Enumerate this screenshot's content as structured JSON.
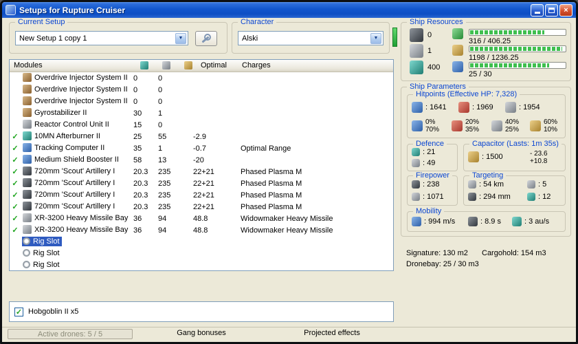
{
  "icons": {
    "dropdown_arrow": "▼",
    "check": "✓",
    "close": "×"
  },
  "window": {
    "title": "Setups for Rupture Cruiser"
  },
  "setup": {
    "group_label": "Current Setup",
    "value": "New Setup 1 copy 1"
  },
  "character": {
    "group_label": "Character",
    "value": "Alski"
  },
  "modules": {
    "title": "Modules",
    "optimal_header": "Optimal",
    "charges_header": "Charges",
    "rows": [
      {
        "checked": false,
        "selected": false,
        "ic": "brown",
        "icon": "overdrive-injector-icon",
        "name": "Overdrive Injector System II",
        "v1": "0",
        "v2": "0",
        "opt": "",
        "charge": ""
      },
      {
        "checked": false,
        "selected": false,
        "ic": "brown",
        "icon": "overdrive-injector-icon",
        "name": "Overdrive Injector System II",
        "v1": "0",
        "v2": "0",
        "opt": "",
        "charge": ""
      },
      {
        "checked": false,
        "selected": false,
        "ic": "brown",
        "icon": "overdrive-injector-icon",
        "name": "Overdrive Injector System II",
        "v1": "0",
        "v2": "0",
        "opt": "",
        "charge": ""
      },
      {
        "checked": false,
        "selected": false,
        "ic": "brown",
        "icon": "gyrostabilizer-icon",
        "name": "Gyrostabilizer II",
        "v1": "30",
        "v2": "1",
        "opt": "",
        "charge": ""
      },
      {
        "checked": false,
        "selected": false,
        "ic": "gray",
        "icon": "reactor-control-unit-icon",
        "name": "Reactor Control Unit II",
        "v1": "15",
        "v2": "0",
        "opt": "",
        "charge": ""
      },
      {
        "checked": true,
        "selected": false,
        "ic": "teal",
        "icon": "afterburner-icon",
        "name": "10MN Afterburner II",
        "v1": "25",
        "v2": "55",
        "opt": "-2.9",
        "charge": ""
      },
      {
        "checked": true,
        "selected": false,
        "ic": "blue",
        "icon": "tracking-computer-icon",
        "name": "Tracking Computer II",
        "v1": "35",
        "v2": "1",
        "opt": "-0.7",
        "charge": "Optimal Range"
      },
      {
        "checked": true,
        "selected": false,
        "ic": "blue",
        "icon": "shield-booster-icon",
        "name": "Medium Shield Booster II",
        "v1": "58",
        "v2": "13",
        "opt": "-20",
        "charge": ""
      },
      {
        "checked": true,
        "selected": false,
        "ic": "dark",
        "icon": "artillery-turret-icon",
        "name": "720mm 'Scout' Artillery I",
        "v1": "20.3",
        "v2": "235",
        "opt": "22+21",
        "charge": "Phased Plasma M"
      },
      {
        "checked": true,
        "selected": false,
        "ic": "dark",
        "icon": "artillery-turret-icon",
        "name": "720mm 'Scout' Artillery I",
        "v1": "20.3",
        "v2": "235",
        "opt": "22+21",
        "charge": "Phased Plasma M"
      },
      {
        "checked": true,
        "selected": false,
        "ic": "dark",
        "icon": "artillery-turret-icon",
        "name": "720mm 'Scout' Artillery I",
        "v1": "20.3",
        "v2": "235",
        "opt": "22+21",
        "charge": "Phased Plasma M"
      },
      {
        "checked": true,
        "selected": false,
        "ic": "dark",
        "icon": "artillery-turret-icon",
        "name": "720mm 'Scout' Artillery I",
        "v1": "20.3",
        "v2": "235",
        "opt": "22+21",
        "charge": "Phased Plasma M"
      },
      {
        "checked": true,
        "selected": false,
        "ic": "gray",
        "icon": "missile-bay-icon",
        "name": "XR-3200 Heavy Missile Bay",
        "v1": "36",
        "v2": "94",
        "opt": "48.8",
        "charge": "Widowmaker Heavy Missile"
      },
      {
        "checked": true,
        "selected": false,
        "ic": "gray",
        "icon": "missile-bay-icon",
        "name": "XR-3200 Heavy Missile Bay",
        "v1": "36",
        "v2": "94",
        "opt": "48.8",
        "charge": "Widowmaker Heavy Missile"
      },
      {
        "checked": false,
        "selected": true,
        "ic": "rig",
        "icon": "rig-slot-icon",
        "name": "Rig Slot",
        "v1": "",
        "v2": "",
        "opt": "",
        "charge": ""
      },
      {
        "checked": false,
        "selected": false,
        "ic": "rig",
        "icon": "rig-slot-icon",
        "name": "Rig Slot",
        "v1": "",
        "v2": "",
        "opt": "",
        "charge": ""
      },
      {
        "checked": false,
        "selected": false,
        "ic": "rig",
        "icon": "rig-slot-icon",
        "name": "Rig Slot",
        "v1": "",
        "v2": "",
        "opt": "",
        "charge": ""
      }
    ]
  },
  "drones": {
    "label": "Hobgoblin II x5",
    "checked": true
  },
  "footer": {
    "active_drones": "Active drones: 5 / 5",
    "gang_bonuses": "Gang bonuses",
    "projected_effects": "Projected effects"
  },
  "resources": {
    "group_label": "Ship Resources",
    "slots": [
      {
        "icon": "turret-hardpoints-icon",
        "value": "0"
      },
      {
        "icon": "launcher-hardpoints-icon",
        "value": "1"
      },
      {
        "icon": "calibration-icon",
        "value": "400"
      }
    ],
    "bars": [
      {
        "icon": "cpu-icon",
        "text": "316 / 406.25",
        "pct": 78
      },
      {
        "icon": "powergrid-icon",
        "text": "1198 / 1236.25",
        "pct": 97
      },
      {
        "icon": "dronebay-icon",
        "text": "25 / 30",
        "pct": 83
      }
    ]
  },
  "parameters": {
    "group_label": "Ship Parameters",
    "hitpoints": {
      "label": "Hitpoints (Effective HP: 7,328)",
      "shield": ": 1641",
      "armor": ": 1969",
      "hull": ": 1954",
      "resists": [
        {
          "name": "em",
          "top": "0%",
          "bottom": "70%"
        },
        {
          "name": "thermal",
          "top": "20%",
          "bottom": "35%"
        },
        {
          "name": "kinetic",
          "top": "40%",
          "bottom": "25%"
        },
        {
          "name": "explosive",
          "top": "60%",
          "bottom": "10%"
        }
      ]
    },
    "defence": {
      "label": "Defence",
      "v1": ": 21",
      "v2": ": 49"
    },
    "capacitor": {
      "label": "Capacitor (Lasts: 1m 35s)",
      "amount": ": 1500",
      "drain": "- 23.6",
      "peak": "+10.8"
    },
    "firepower": {
      "label": "Firepower",
      "v1": ": 238",
      "v2": ": 1071"
    },
    "targeting": {
      "label": "Targeting",
      "range": ": 54 km",
      "scan_res": ": 294 mm",
      "max_targets": ": 5",
      "sensor_strength": ": 12"
    },
    "mobility": {
      "label": "Mobility",
      "speed": ": 994 m/s",
      "align": ": 8.9 s",
      "warp": ": 3 au/s"
    },
    "stats": {
      "signature": "Signature: 130 m2",
      "cargohold": "Cargohold: 154 m3",
      "dronebay": "Dronebay: 25 / 30 m3"
    }
  }
}
